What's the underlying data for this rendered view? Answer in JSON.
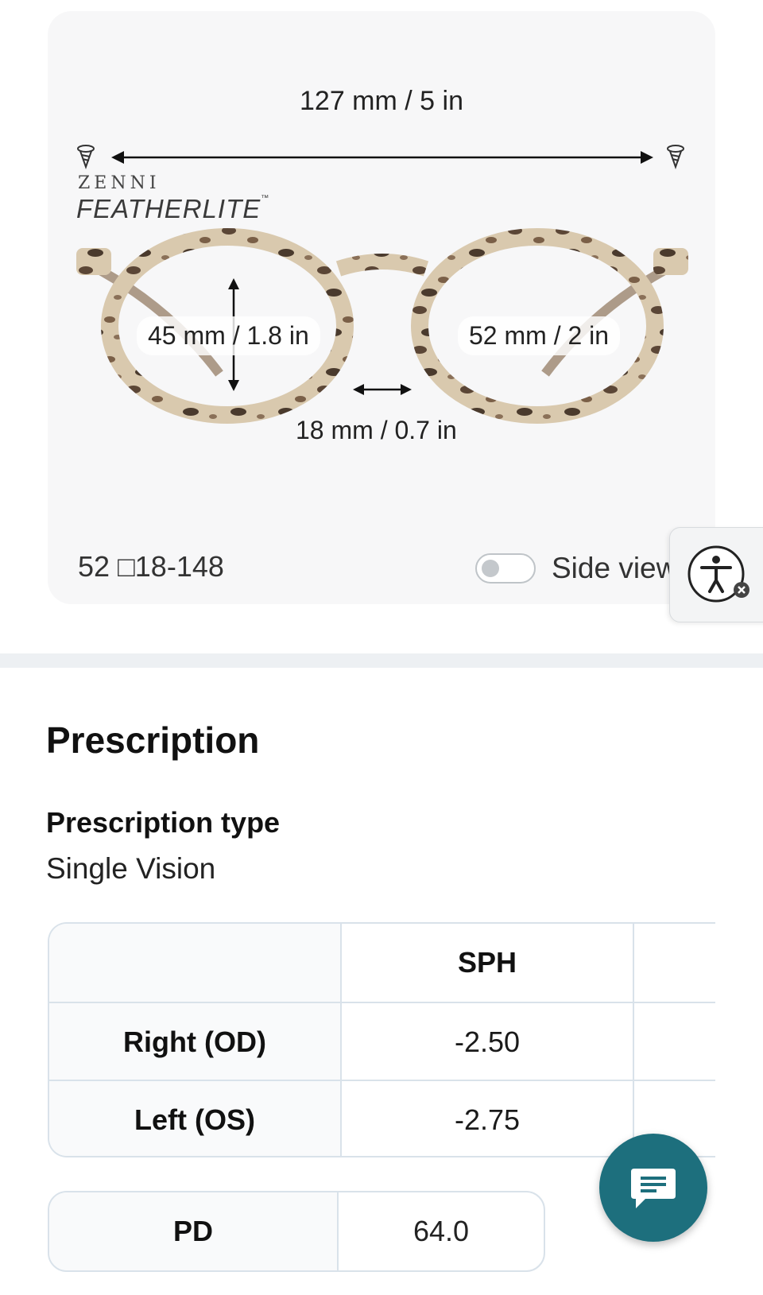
{
  "frame": {
    "total_width": "127 mm / 5 in",
    "brand_top": "ZENNI",
    "brand_name": "FEATHERLITE",
    "brand_tm": "™",
    "lens_height": "45 mm / 1.8 in",
    "lens_width": "52 mm / 2 in",
    "bridge_width": "18 mm / 0.7 in",
    "size_code": "52 □18-148",
    "side_view_label": "Side view",
    "side_view_on": false
  },
  "colors": {
    "accent_chat": "#1d6f7d",
    "divider": "#edf0f3",
    "card_bg": "#f7f7f8"
  },
  "icons": {
    "accessibility": "accessibility-icon",
    "chat": "chat-icon",
    "screw": "screw-icon"
  },
  "prescription": {
    "title": "Prescription",
    "type_label": "Prescription type",
    "type_value": "Single Vision",
    "table": {
      "headers": [
        "",
        "SPH",
        ""
      ],
      "rows": [
        {
          "label": "Right (OD)",
          "sph": "-2.50"
        },
        {
          "label": "Left (OS)",
          "sph": "-2.75"
        }
      ]
    },
    "pd_label": "PD",
    "pd_value": "64.0"
  }
}
